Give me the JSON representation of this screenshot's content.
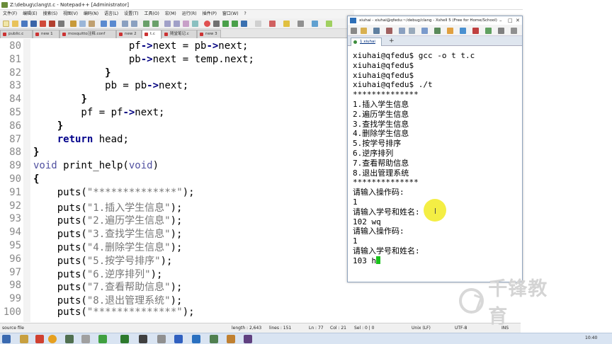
{
  "notepad": {
    "title": "Z:\\debug\\clang\\t.c - Notepad++ [Administrator]",
    "menu": [
      "文件(F)",
      "编辑(E)",
      "搜索(S)",
      "视图(V)",
      "编码(N)",
      "语言(L)",
      "设置(T)",
      "工具(O)",
      "宏(M)",
      "运行(R)",
      "插件(P)",
      "窗口(W)",
      "?"
    ],
    "tabs": [
      "public.c",
      "new 1",
      "mosquitto注释.conf",
      "new 2",
      "t.c",
      "随堂笔记.c",
      "new 3"
    ],
    "active_tab": "t.c",
    "lines": [
      {
        "num": "80",
        "code": "                pf->next = pb->next;"
      },
      {
        "num": "81",
        "code": "                pb->next = temp.next;"
      },
      {
        "num": "82",
        "code": "            }"
      },
      {
        "num": "83",
        "code": "            pb = pb->next;"
      },
      {
        "num": "84",
        "code": "        }"
      },
      {
        "num": "85",
        "code": "        pf = pf->next;"
      },
      {
        "num": "86",
        "code": "    }"
      },
      {
        "num": "87",
        "code": "    return head;"
      },
      {
        "num": "88",
        "code": "}"
      },
      {
        "num": "89",
        "code": "void print_help(void)"
      },
      {
        "num": "90",
        "code": "{"
      },
      {
        "num": "91",
        "code": "    puts(\"**************\");"
      },
      {
        "num": "92",
        "code": "    puts(\"1.插入学生信息\");"
      },
      {
        "num": "93",
        "code": "    puts(\"2.遍历学生信息\");"
      },
      {
        "num": "94",
        "code": "    puts(\"3.查找学生信息\");"
      },
      {
        "num": "95",
        "code": "    puts(\"4.删除学生信息\");"
      },
      {
        "num": "96",
        "code": "    puts(\"5.按学号排序\");"
      },
      {
        "num": "97",
        "code": "    puts(\"6.逆序排列\");"
      },
      {
        "num": "98",
        "code": "    puts(\"7.查看帮助信息\");"
      },
      {
        "num": "99",
        "code": "    puts(\"8.退出管理系统\");"
      },
      {
        "num": "100",
        "code": "    puts(\"**************\");"
      }
    ],
    "status": {
      "file_type": "source file",
      "length": "length : 2,643",
      "lines": "lines : 151",
      "position": "Ln : 77",
      "col": "Col : 21",
      "sel": "Sel : 0 | 0",
      "eol": "Unix (LF)",
      "encoding": "UTF-8",
      "mode": "INS"
    }
  },
  "xshell": {
    "title": "xiuhai - xiuhai@qfedu:~/debug/clang - Xshell 5 (Free for Home/School)",
    "tab_label": "1 xiuhai",
    "add_tab": "+",
    "terminal_lines": [
      "xiuhai@qfedu$ gcc -o t t.c",
      "xiuhai@qfedu$",
      "xiuhai@qfedu$",
      "xiuhai@qfedu$ ./t",
      "**************",
      "1.插入学生信息",
      "2.遍历学生信息",
      "3.查找学生信息",
      "4.删除学生信息",
      "5.按学号排序",
      "6.逆序排列",
      "7.查看帮助信息",
      "8.退出管理系统",
      "**************",
      "请输入操作码:",
      "1",
      "请输入学号和姓名:",
      "102 wq",
      "请输入操作码:",
      "1",
      "请输入学号和姓名:"
    ],
    "current_input": "103 h"
  },
  "watermark": "千锋教育",
  "clock": "10:40",
  "colors": {
    "cursor": "#19c21b",
    "pointer": "#f4ee3a",
    "keyword": "#00008b"
  }
}
